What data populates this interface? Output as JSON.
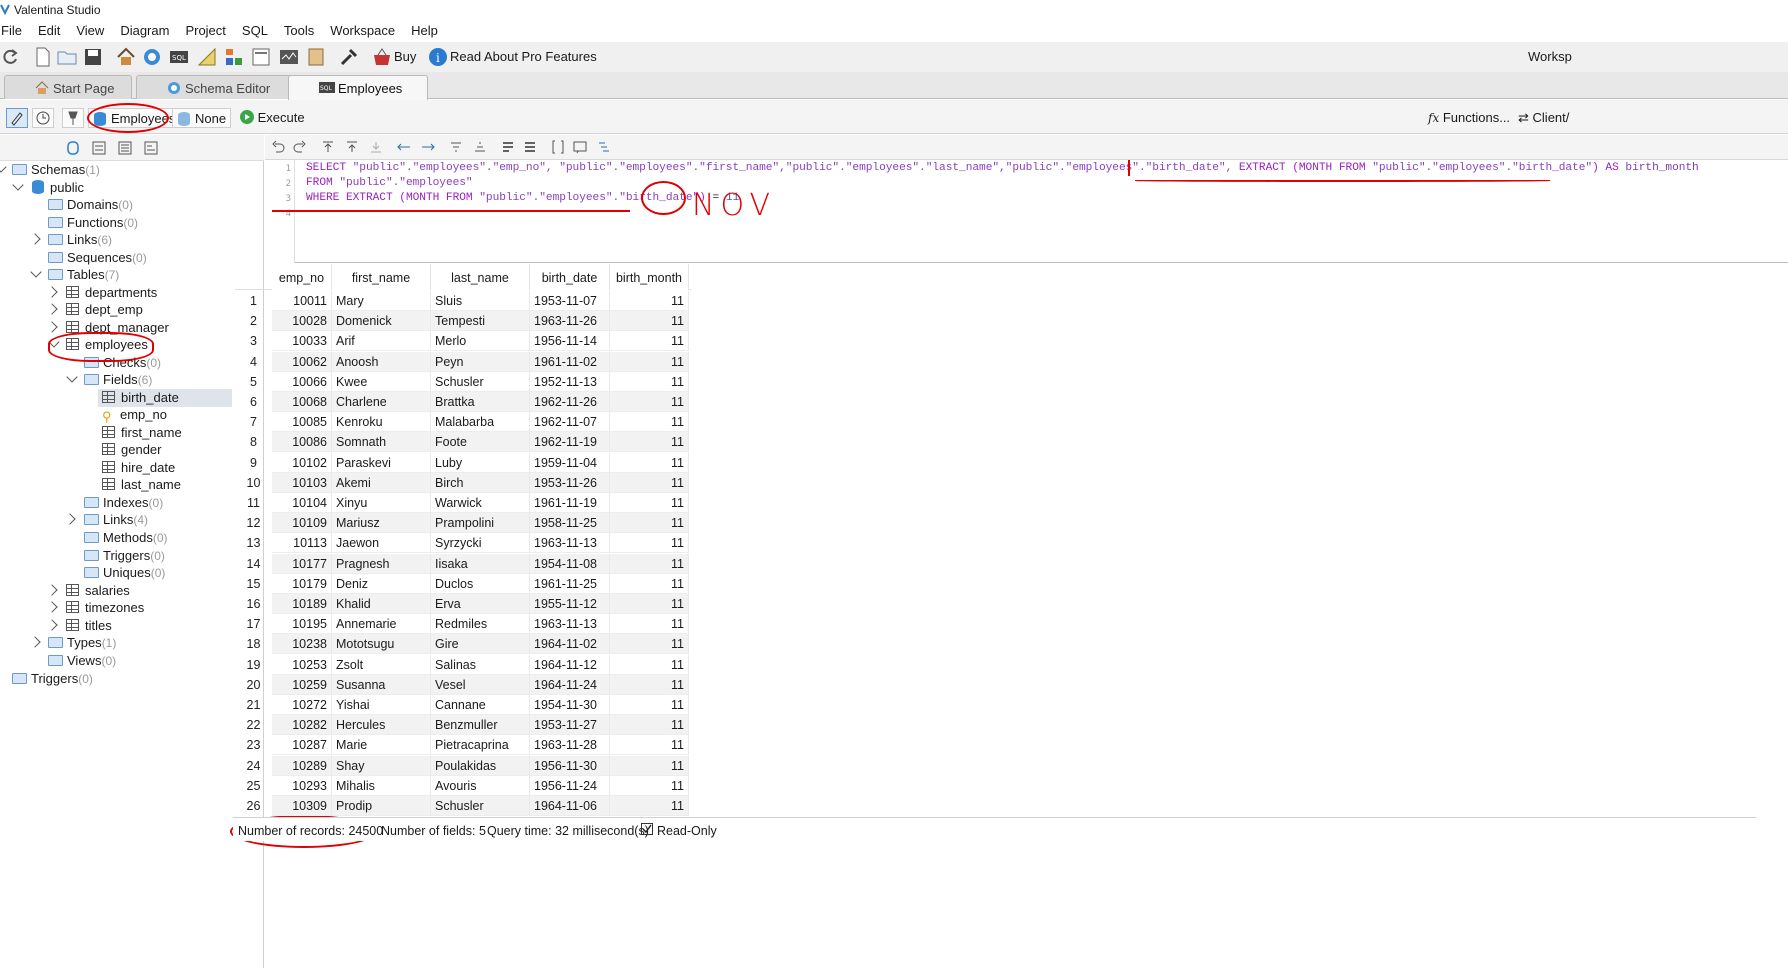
{
  "window": {
    "title": "Valentina Studio"
  },
  "menu": [
    "File",
    "Edit",
    "View",
    "Diagram",
    "Project",
    "SQL",
    "Tools",
    "Workspace",
    "Help"
  ],
  "toolbar": {
    "buy_label": "Buy",
    "pro_label": "Read About Pro Features",
    "workspace_label": "Worksp"
  },
  "tabs": [
    {
      "label": "Start Page",
      "icon": "home-icon"
    },
    {
      "label": "Schema Editor",
      "icon": "schema-icon"
    },
    {
      "label": "Employees",
      "icon": "sql-icon"
    }
  ],
  "query_toolbar": {
    "db_label": "Employees",
    "schema_label": "None",
    "execute_label": "Execute",
    "functions_label": "Functions...",
    "client_label": "Client/"
  },
  "tree": {
    "schemas": {
      "label": "Schemas",
      "count": "(1)"
    },
    "public": "public",
    "domains": {
      "label": "Domains",
      "count": "(0)"
    },
    "functions": {
      "label": "Functions",
      "count": "(0)"
    },
    "links": {
      "label": "Links",
      "count": "(6)"
    },
    "sequences": {
      "label": "Sequences",
      "count": "(0)"
    },
    "tables": {
      "label": "Tables",
      "count": "(7)"
    },
    "t_departments": "departments",
    "t_dept_emp": "dept_emp",
    "t_dept_manager": "dept_manager",
    "t_employees": "employees",
    "checks": {
      "label": "Checks",
      "count": "(0)"
    },
    "fields": {
      "label": "Fields",
      "count": "(6)"
    },
    "f_birth_date": "birth_date",
    "f_emp_no": "emp_no",
    "f_first_name": "first_name",
    "f_gender": "gender",
    "f_hire_date": "hire_date",
    "f_last_name": "last_name",
    "indexes": {
      "label": "Indexes",
      "count": "(0)"
    },
    "links2": {
      "label": "Links",
      "count": "(4)"
    },
    "methods": {
      "label": "Methods",
      "count": "(0)"
    },
    "triggers2": {
      "label": "Triggers",
      "count": "(0)"
    },
    "uniques": {
      "label": "Uniques",
      "count": "(0)"
    },
    "t_salaries": "salaries",
    "t_timezones": "timezones",
    "t_titles": "titles",
    "types": {
      "label": "Types",
      "count": "(1)"
    },
    "views": {
      "label": "Views",
      "count": "(0)"
    },
    "triggers": {
      "label": "Triggers",
      "count": "(0)"
    }
  },
  "editor": {
    "line_numbers": [
      "1",
      "2",
      "3",
      "4"
    ],
    "l1_kw": "SELECT",
    "l1_rest": " \"public\".\"employees\".\"emp_no\", \"public\".\"employees\".\"first_name\",\"public\".\"employees\".\"last_name\",\"public\".\"employees\".\"birth_date\",",
    "l1_kw2": " EXTRACT (MONTH FROM ",
    "l1_str2": "\"public\".\"employees\".\"birth_date\"",
    "l1_kw3": ") AS ",
    "l1_alias": "birth_month",
    "l2_kw": "FROM",
    "l2_rest": " \"public\".\"employees\"",
    "l3_kw": "WHERE EXTRACT (MONTH FROM ",
    "l3_str": "\"public\".\"employees\".\"birth_date\"",
    "l3_close": ")",
    "l3_eq": " = ",
    "l3_num": "11"
  },
  "annotation": {
    "handwritten": "NOV"
  },
  "grid": {
    "columns": [
      "emp_no",
      "first_name",
      "last_name",
      "birth_date",
      "birth_month"
    ],
    "rows": [
      [
        "1",
        "10011",
        "Mary",
        "Sluis",
        "1953-11-07",
        "11"
      ],
      [
        "2",
        "10028",
        "Domenick",
        "Tempesti",
        "1963-11-26",
        "11"
      ],
      [
        "3",
        "10033",
        "Arif",
        "Merlo",
        "1956-11-14",
        "11"
      ],
      [
        "4",
        "10062",
        "Anoosh",
        "Peyn",
        "1961-11-02",
        "11"
      ],
      [
        "5",
        "10066",
        "Kwee",
        "Schusler",
        "1952-11-13",
        "11"
      ],
      [
        "6",
        "10068",
        "Charlene",
        "Brattka",
        "1962-11-26",
        "11"
      ],
      [
        "7",
        "10085",
        "Kenroku",
        "Malabarba",
        "1962-11-07",
        "11"
      ],
      [
        "8",
        "10086",
        "Somnath",
        "Foote",
        "1962-11-19",
        "11"
      ],
      [
        "9",
        "10102",
        "Paraskevi",
        "Luby",
        "1959-11-04",
        "11"
      ],
      [
        "10",
        "10103",
        "Akemi",
        "Birch",
        "1953-11-26",
        "11"
      ],
      [
        "11",
        "10104",
        "Xinyu",
        "Warwick",
        "1961-11-19",
        "11"
      ],
      [
        "12",
        "10109",
        "Mariusz",
        "Prampolini",
        "1958-11-25",
        "11"
      ],
      [
        "13",
        "10113",
        "Jaewon",
        "Syrzycki",
        "1963-11-13",
        "11"
      ],
      [
        "14",
        "10177",
        "Pragnesh",
        "Iisaka",
        "1954-11-08",
        "11"
      ],
      [
        "15",
        "10179",
        "Deniz",
        "Duclos",
        "1961-11-25",
        "11"
      ],
      [
        "16",
        "10189",
        "Khalid",
        "Erva",
        "1955-11-12",
        "11"
      ],
      [
        "17",
        "10195",
        "Annemarie",
        "Redmiles",
        "1963-11-13",
        "11"
      ],
      [
        "18",
        "10238",
        "Mototsugu",
        "Gire",
        "1964-11-02",
        "11"
      ],
      [
        "19",
        "10253",
        "Zsolt",
        "Salinas",
        "1964-11-12",
        "11"
      ],
      [
        "20",
        "10259",
        "Susanna",
        "Vesel",
        "1964-11-24",
        "11"
      ],
      [
        "21",
        "10272",
        "Yishai",
        "Cannane",
        "1954-11-30",
        "11"
      ],
      [
        "22",
        "10282",
        "Hercules",
        "Benzmuller",
        "1953-11-27",
        "11"
      ],
      [
        "23",
        "10287",
        "Marie",
        "Pietracaprina",
        "1963-11-28",
        "11"
      ],
      [
        "24",
        "10289",
        "Shay",
        "Poulakidas",
        "1956-11-30",
        "11"
      ],
      [
        "25",
        "10293",
        "Mihalis",
        "Avouris",
        "1956-11-24",
        "11"
      ],
      [
        "26",
        "10309",
        "Prodip",
        "Schusler",
        "1964-11-06",
        "11"
      ]
    ]
  },
  "status": {
    "records": "Number of records: 24500",
    "fields": "Number of fields: 5",
    "query_time": "Query time: 32 millisecond(s)",
    "readonly": "Read-Only"
  },
  "colors": {
    "annotation": "#e00000",
    "keyword": "#9c1ec4",
    "string": "#8a3fbd",
    "number": "#2f5fd0"
  }
}
